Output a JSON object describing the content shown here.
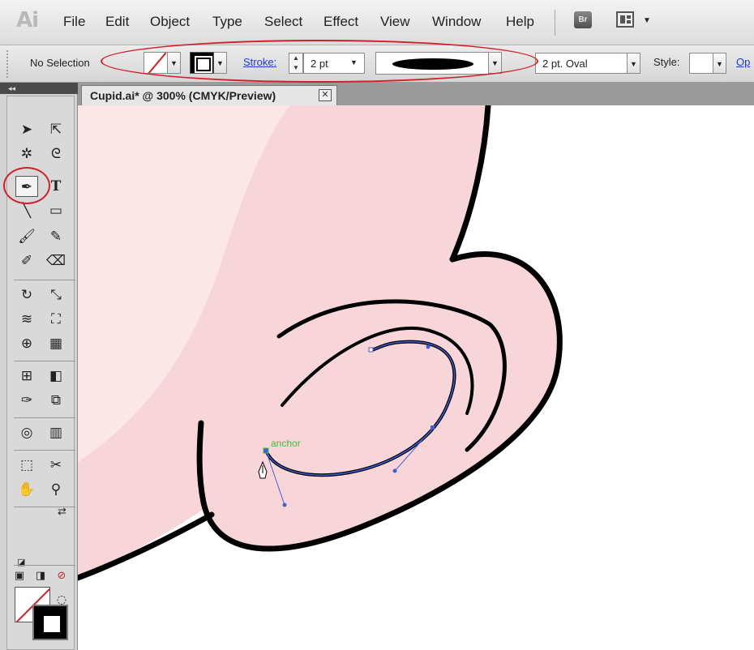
{
  "app": {
    "logo": "Ai"
  },
  "menu": {
    "items": [
      "File",
      "Edit",
      "Object",
      "Type",
      "Select",
      "Effect",
      "View",
      "Window",
      "Help"
    ],
    "bridge_label": "Br"
  },
  "control_bar": {
    "selection_status": "No Selection",
    "stroke_label": "Stroke:",
    "stroke_weight": "2 pt",
    "brush_name": "2 pt. Oval",
    "style_label": "Style:",
    "opacity_label": "Op"
  },
  "tools_panel": {
    "collapse_glyph": "◂◂",
    "active_tool": "pen-tool"
  },
  "document": {
    "tab_title": "Cupid.ai* @ 300% (CMYK/Preview)",
    "close_glyph": "✕"
  },
  "canvas": {
    "anchor_label": "anchor",
    "colors": {
      "skin": "#f8d5d9",
      "highlight": "#fbe6e8",
      "outline": "#000000",
      "path": "#3f5fd8",
      "annotation": "#d2202a"
    }
  }
}
